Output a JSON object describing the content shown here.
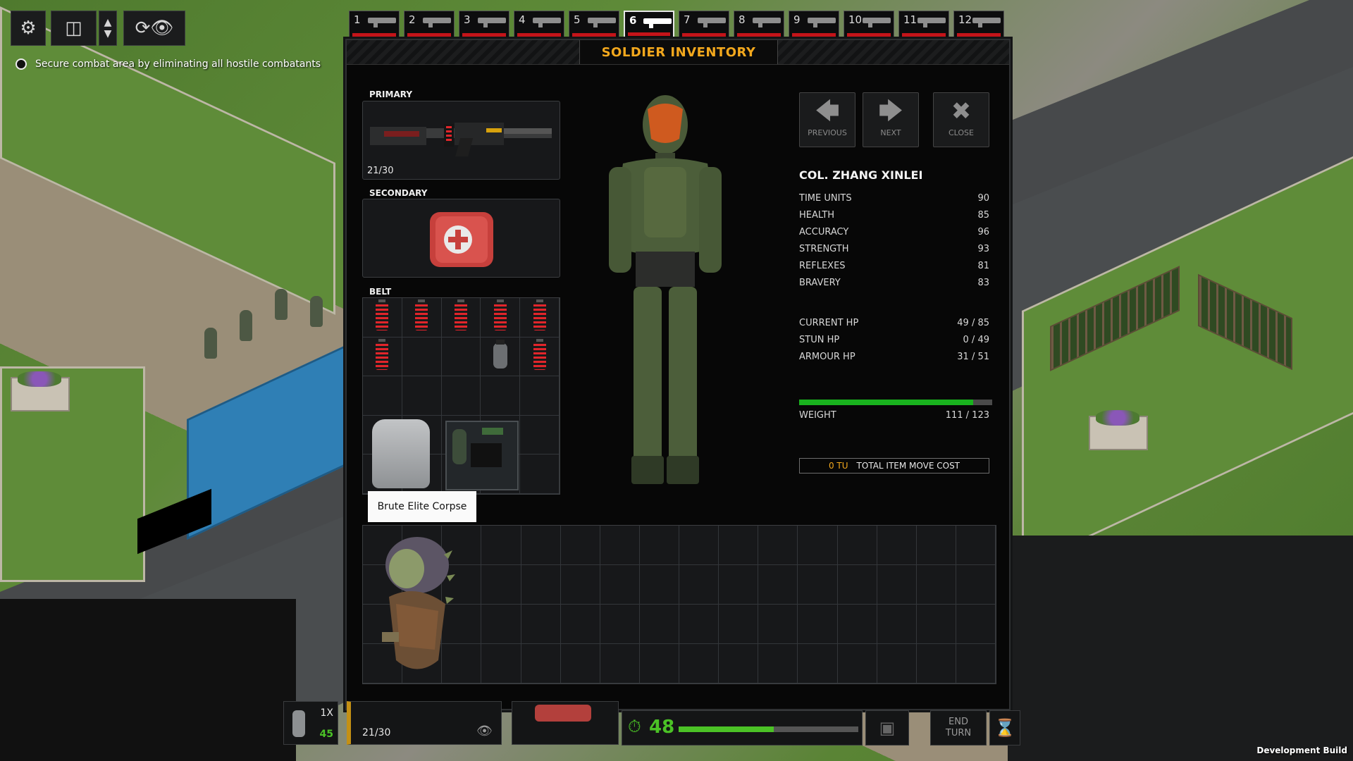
{
  "objective": {
    "text": "Secure combat area by eliminating all hostile combatants"
  },
  "squad_tabs": [
    {
      "num": "1",
      "selected": false
    },
    {
      "num": "2",
      "selected": false
    },
    {
      "num": "3",
      "selected": false
    },
    {
      "num": "4",
      "selected": false
    },
    {
      "num": "5",
      "selected": false
    },
    {
      "num": "6",
      "selected": true
    },
    {
      "num": "7",
      "selected": false
    },
    {
      "num": "8",
      "selected": false
    },
    {
      "num": "9",
      "selected": false
    },
    {
      "num": "10",
      "selected": false
    },
    {
      "num": "11",
      "selected": false
    },
    {
      "num": "12",
      "selected": false
    }
  ],
  "inventory": {
    "title": "SOLDIER INVENTORY",
    "primary_label": "PRIMARY",
    "primary_ammo": "21/30",
    "secondary_label": "SECONDARY",
    "belt_label": "BELT",
    "tooltip": "Brute Elite Corpse"
  },
  "nav": {
    "previous": "PREVIOUS",
    "next": "NEXT",
    "close": "CLOSE"
  },
  "soldier": {
    "name": "COL. ZHANG XINLEI",
    "stats": [
      {
        "label": "TIME UNITS",
        "value": "90"
      },
      {
        "label": "HEALTH",
        "value": "85"
      },
      {
        "label": "ACCURACY",
        "value": "96"
      },
      {
        "label": "STRENGTH",
        "value": "93"
      },
      {
        "label": "REFLEXES",
        "value": "81"
      },
      {
        "label": "BRAVERY",
        "value": "83"
      }
    ],
    "hp": [
      {
        "label": "CURRENT HP",
        "value": "49 / 85"
      },
      {
        "label": "STUN HP",
        "value": "0 / 49"
      },
      {
        "label": "ARMOUR HP",
        "value": "31 / 51"
      }
    ],
    "weight_label": "WEIGHT",
    "weight_value": "111 / 123",
    "weight_fraction": 0.902,
    "tu_cost": "0 TU",
    "tu_cost_label": "TOTAL ITEM MOVE COST"
  },
  "bottom_hud": {
    "grenade_mult": "1X",
    "grenade_count": "45",
    "weapon_ammo": "21/30",
    "time_units": "48",
    "tu_fraction": 0.53,
    "end_turn": "END TURN"
  },
  "footer": {
    "dev_build": "Development Build"
  },
  "colors": {
    "accent": "#f3a81d",
    "health": "#c41419",
    "weight": "#19b21e",
    "tu": "#4bc226"
  }
}
